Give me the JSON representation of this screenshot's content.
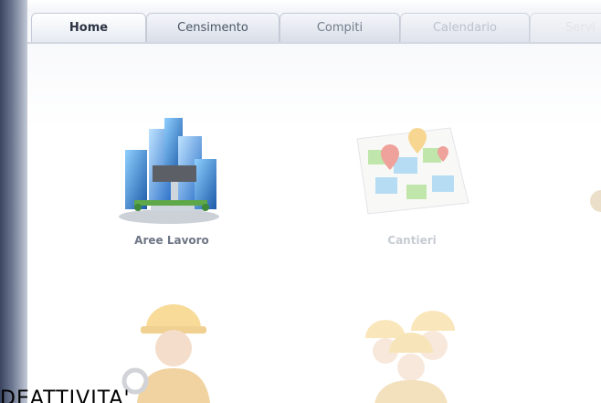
{
  "tabs": [
    {
      "label": "Home",
      "active": true
    },
    {
      "label": "Censimento",
      "active": false
    },
    {
      "label": "Compiti",
      "active": false
    },
    {
      "label": "Calendario",
      "active": false
    },
    {
      "label": "Servi",
      "active": false
    }
  ],
  "tiles": [
    {
      "label": "Aree Lavoro",
      "icon": "buildings-icon"
    },
    {
      "label": "Cantieri",
      "icon": "map-pins-icon"
    }
  ],
  "caption": "DEATTIVITA'"
}
